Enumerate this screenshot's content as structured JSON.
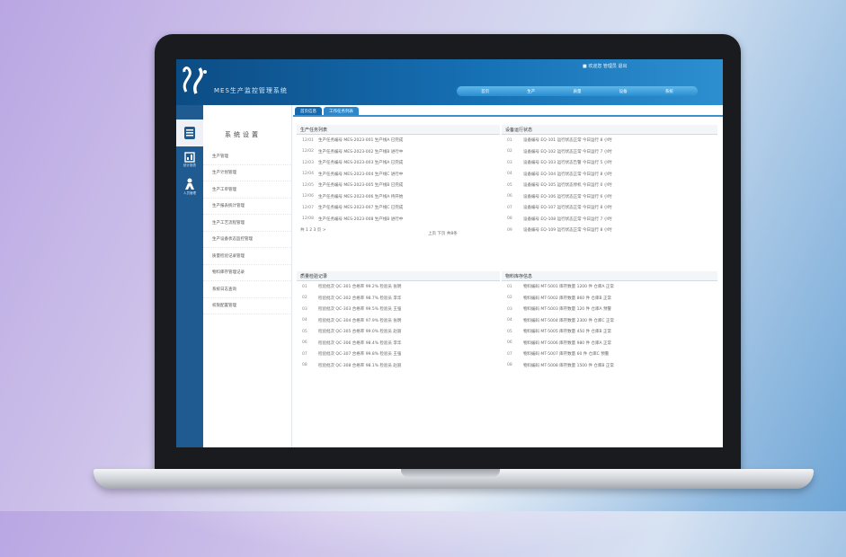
{
  "app": {
    "title": "MES生产监控管理系统",
    "user_info": "■ 欢迎您 管理员 退出",
    "top_nav": [
      "首页",
      "生产",
      "质量",
      "设备",
      "系统"
    ]
  },
  "icon_bar": [
    {
      "icon": "document-icon",
      "label": ""
    },
    {
      "icon": "chart-icon",
      "label": "统计报表"
    },
    {
      "icon": "person-icon",
      "label": "人员管理"
    }
  ],
  "menu": {
    "title": "系统设置",
    "items": [
      "生产管理",
      "生产计划管理",
      "生产工单管理",
      "生产报表统计管理",
      "生产工艺流程管理",
      "生产设备状态监控管理",
      "质量检验记录管理",
      "物料库存管理记录",
      "系统日志查询",
      "权限配置管理"
    ]
  },
  "tabs": [
    "首页信息",
    "工作任务列表"
  ],
  "panels": [
    {
      "title": "生产任务列表",
      "rows": [
        {
          "date": "12/01",
          "text": "生产任务编号 MES-2023-001 生产线A 已完成"
        },
        {
          "date": "12/02",
          "text": "生产任务编号 MES-2023-002 生产线B 进行中"
        },
        {
          "date": "12/03",
          "text": "生产任务编号 MES-2023-003 生产线A 已完成"
        },
        {
          "date": "12/04",
          "text": "生产任务编号 MES-2023-004 生产线C 进行中"
        },
        {
          "date": "12/05",
          "text": "生产任务编号 MES-2023-005 生产线B 已完成"
        },
        {
          "date": "12/06",
          "text": "生产任务编号 MES-2023-006 生产线A 待开始"
        },
        {
          "date": "12/07",
          "text": "生产任务编号 MES-2023-007 生产线C 已完成"
        },
        {
          "date": "12/08",
          "text": "生产任务编号 MES-2023-008 生产线B 进行中"
        }
      ]
    },
    {
      "title": "设备运行状态",
      "rows": [
        {
          "date": "01",
          "text": "设备编号 EQ-101 运行状态正常 今日运行 8 小时"
        },
        {
          "date": "02",
          "text": "设备编号 EQ-102 运行状态正常 今日运行 7 小时"
        },
        {
          "date": "03",
          "text": "设备编号 EQ-103 运行状态告警 今日运行 5 小时"
        },
        {
          "date": "04",
          "text": "设备编号 EQ-104 运行状态正常 今日运行 8 小时"
        },
        {
          "date": "05",
          "text": "设备编号 EQ-105 运行状态停机 今日运行 0 小时"
        },
        {
          "date": "06",
          "text": "设备编号 EQ-106 运行状态正常 今日运行 6 小时"
        },
        {
          "date": "07",
          "text": "设备编号 EQ-107 运行状态正常 今日运行 8 小时"
        },
        {
          "date": "08",
          "text": "设备编号 EQ-108 运行状态正常 今日运行 7 小时"
        },
        {
          "date": "09",
          "text": "设备编号 EQ-109 运行状态正常 今日运行 8 小时"
        }
      ]
    },
    {
      "title": "质量检验记录",
      "rows": [
        {
          "date": "01",
          "text": "检验批次 QC-301 合格率 99.2% 检验员 张明"
        },
        {
          "date": "02",
          "text": "检验批次 QC-302 合格率 98.7% 检验员 李华"
        },
        {
          "date": "03",
          "text": "检验批次 QC-303 合格率 99.5% 检验员 王强"
        },
        {
          "date": "04",
          "text": "检验批次 QC-304 合格率 97.9% 检验员 张明"
        },
        {
          "date": "05",
          "text": "检验批次 QC-305 合格率 99.0% 检验员 赵丽"
        },
        {
          "date": "06",
          "text": "检验批次 QC-306 合格率 98.4% 检验员 李华"
        },
        {
          "date": "07",
          "text": "检验批次 QC-307 合格率 99.8% 检验员 王强"
        },
        {
          "date": "08",
          "text": "检验批次 QC-308 合格率 98.1% 检验员 赵丽"
        }
      ]
    },
    {
      "title": "物料库存信息",
      "rows": [
        {
          "date": "01",
          "text": "物料编码 MT-5001 库存数量 1200 件 仓库A 正常"
        },
        {
          "date": "02",
          "text": "物料编码 MT-5002 库存数量 860 件 仓库B 正常"
        },
        {
          "date": "03",
          "text": "物料编码 MT-5003 库存数量 120 件 仓库A 预警"
        },
        {
          "date": "04",
          "text": "物料编码 MT-5004 库存数量 2300 件 仓库C 正常"
        },
        {
          "date": "05",
          "text": "物料编码 MT-5005 库存数量 450 件 仓库B 正常"
        },
        {
          "date": "06",
          "text": "物料编码 MT-5006 库存数量 980 件 仓库A 正常"
        },
        {
          "date": "07",
          "text": "物料编码 MT-5007 库存数量 60 件 仓库C 预警"
        },
        {
          "date": "08",
          "text": "物料编码 MT-5008 库存数量 1500 件 仓库B 正常"
        }
      ]
    }
  ],
  "pager": {
    "left": "共 1 2 3 页 >",
    "center": "上页 下页 共8条"
  }
}
